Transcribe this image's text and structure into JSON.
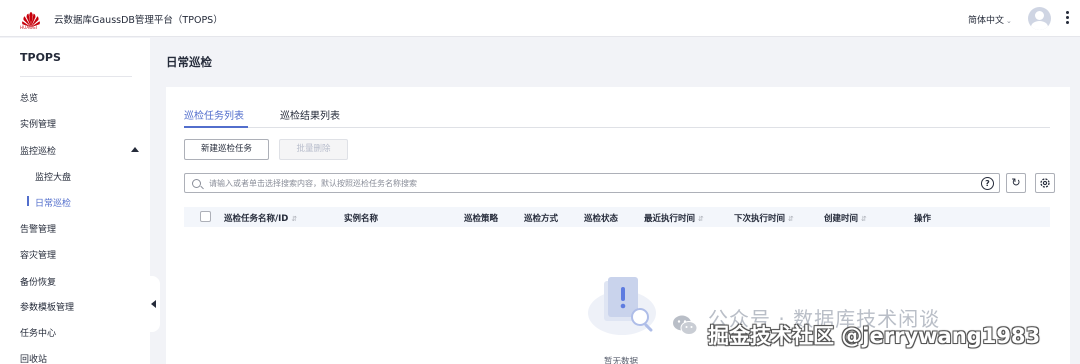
{
  "header": {
    "logo_text": "HUAWEI",
    "app_title": "云数据库GaussDB管理平台（TPOPS）",
    "language": "简体中文",
    "brand_color": "#c7000b"
  },
  "sidebar": {
    "title": "TPOPS",
    "items": [
      {
        "label": "总览"
      },
      {
        "label": "实例管理"
      },
      {
        "label": "监控巡检"
      },
      {
        "label": "监控大盘"
      },
      {
        "label": "日常巡检"
      },
      {
        "label": "告警管理"
      },
      {
        "label": "容灾管理"
      },
      {
        "label": "备份恢复"
      },
      {
        "label": "参数模板管理"
      },
      {
        "label": "任务中心"
      },
      {
        "label": "回收站"
      }
    ],
    "active_item": "日常巡检",
    "accent_color": "#526ecc"
  },
  "main": {
    "page_title": "日常巡检",
    "tabs": [
      {
        "label": "巡检任务列表",
        "active": true
      },
      {
        "label": "巡检结果列表",
        "active": false
      }
    ],
    "toolbar": {
      "create_label": "新建巡检任务",
      "batch_delete_label": "批量删除"
    },
    "search": {
      "placeholder": "请输入或者单击选择搜索内容，默认按照巡检任务名称搜索"
    },
    "table": {
      "columns": [
        {
          "label": "巡检任务名称/ID",
          "sortable": true
        },
        {
          "label": "实例名称",
          "sortable": false
        },
        {
          "label": "巡检策略",
          "sortable": false
        },
        {
          "label": "巡检方式",
          "sortable": false
        },
        {
          "label": "巡检状态",
          "sortable": false
        },
        {
          "label": "最近执行时间",
          "sortable": true
        },
        {
          "label": "下次执行时间",
          "sortable": true
        },
        {
          "label": "创建时间",
          "sortable": true
        },
        {
          "label": "操作",
          "sortable": false
        }
      ],
      "rows": [],
      "empty_text": "暂无数据"
    }
  },
  "watermark": {
    "line1": "公众号 · 数据库技术闲谈",
    "line2": "掘金技术社区 @jerrywang1983"
  }
}
